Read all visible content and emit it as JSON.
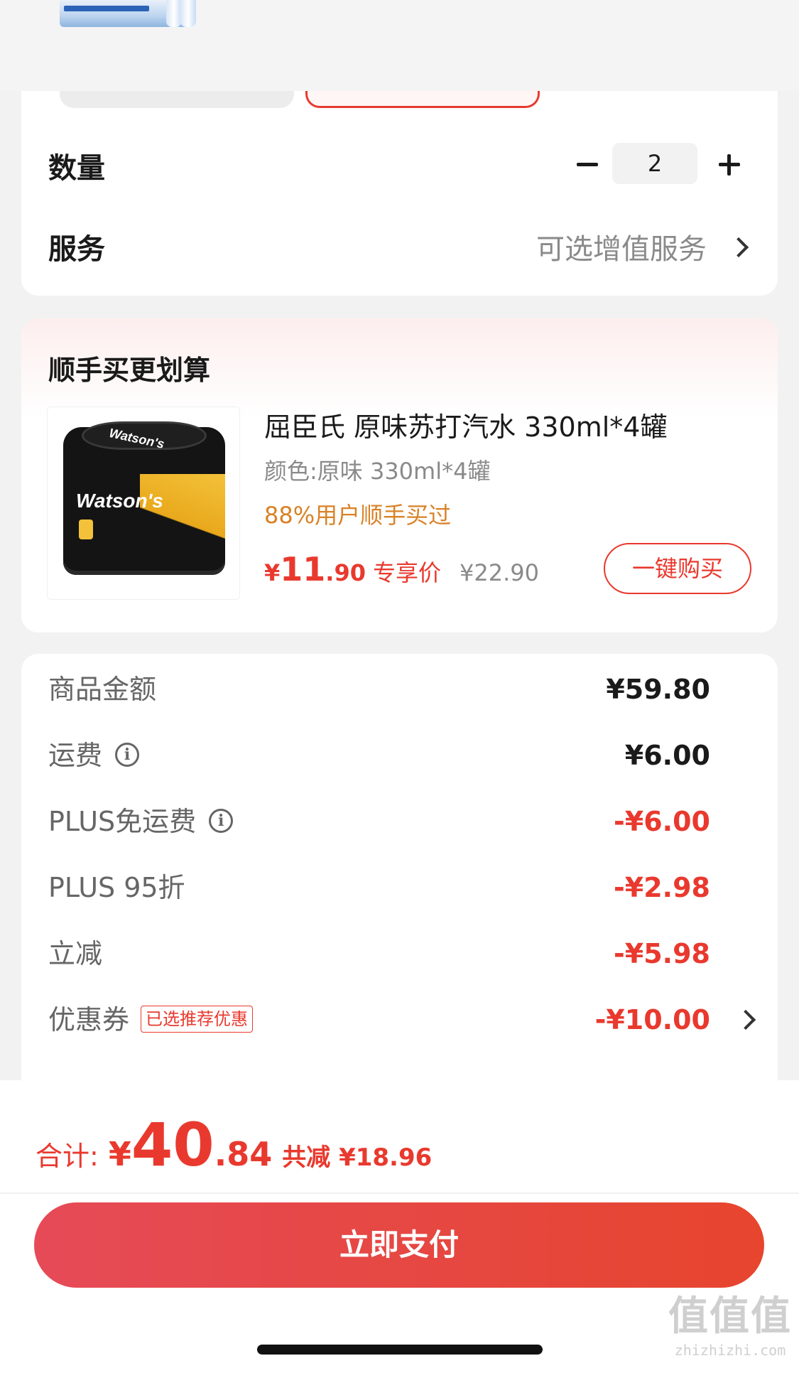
{
  "product_header": {
    "image_alt": "bottled water thumbnail"
  },
  "quantity": {
    "label": "数量",
    "value": "2"
  },
  "service": {
    "label": "服务",
    "value": "可选增值服务"
  },
  "bundle": {
    "title": "顺手买更划算",
    "product_name": "屈臣氏 原味苏打汽水 330ml*4罐",
    "spec": "颜色:原味 330ml*4罐",
    "stat": "88%用户顺手买过",
    "price_currency": "¥",
    "price_int": "11",
    "price_dec": ".90",
    "price_tag": "专享价",
    "original_price": "¥22.90",
    "buy_button": "一键购买",
    "brand": "Watson's"
  },
  "price_breakdown": [
    {
      "label": "商品金额",
      "value": "¥59.80",
      "red": false,
      "info": false
    },
    {
      "label": "运费",
      "value": "¥6.00",
      "red": false,
      "info": true
    },
    {
      "label": "PLUS免运费",
      "value": "-¥6.00",
      "red": true,
      "info": true
    },
    {
      "label": "PLUS 95折",
      "value": "-¥2.98",
      "red": true,
      "info": false
    },
    {
      "label": "立减",
      "value": "-¥5.98",
      "red": true,
      "info": false
    },
    {
      "label": "优惠券",
      "value": "-¥10.00",
      "red": true,
      "info": false,
      "badge": "已选推荐优惠"
    }
  ],
  "total": {
    "label": "合计:",
    "currency": "¥",
    "int": "40",
    "dec": ".84",
    "savings": "共减 ¥18.96"
  },
  "pay_button": "立即支付",
  "watermark": {
    "big": "值值值",
    "small": "zhizhizhi.com"
  },
  "colors": {
    "accent_red": "#e9392e",
    "orange": "#d98226",
    "muted_text": "#8a8a8a"
  }
}
